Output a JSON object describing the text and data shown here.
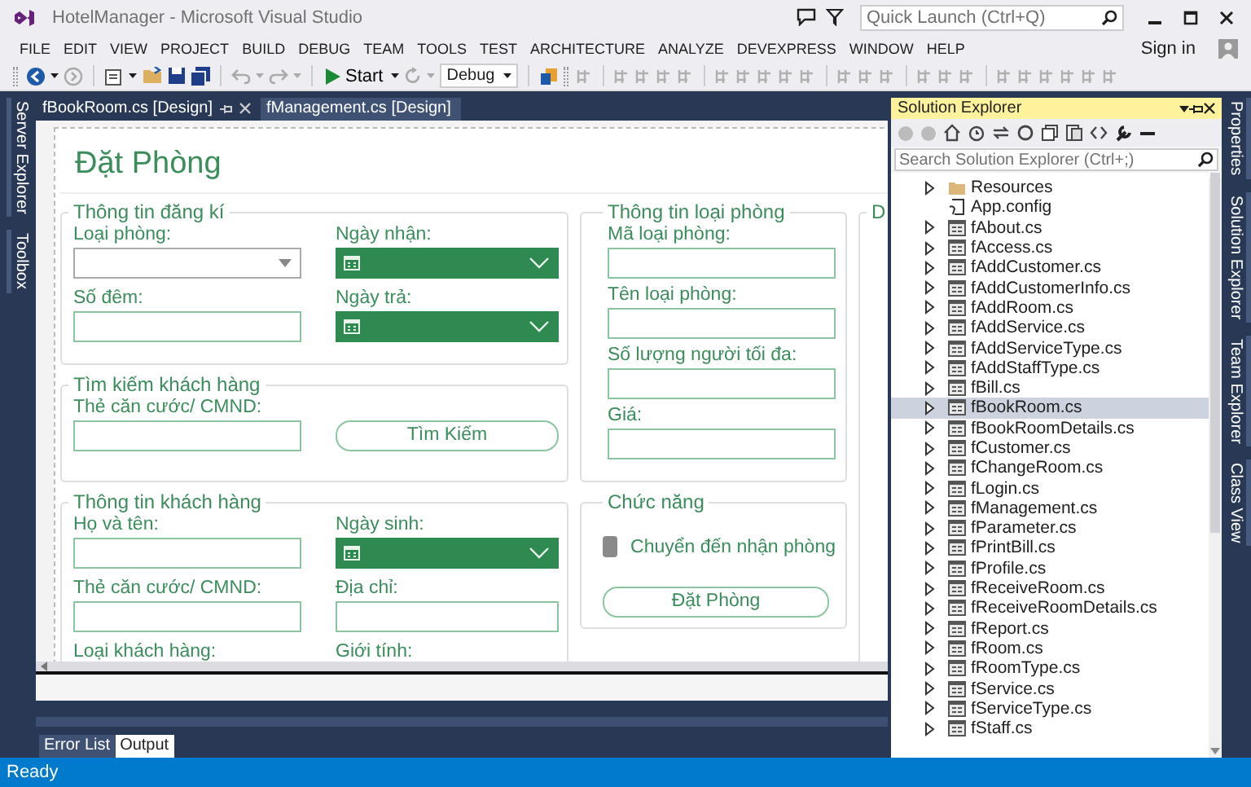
{
  "window": {
    "title": "HotelManager - Microsoft Visual Studio"
  },
  "quick_launch": {
    "placeholder": "Quick Launch (Ctrl+Q)"
  },
  "menu": [
    "FILE",
    "EDIT",
    "VIEW",
    "PROJECT",
    "BUILD",
    "DEBUG",
    "TEAM",
    "TOOLS",
    "TEST",
    "ARCHITECTURE",
    "ANALYZE",
    "DEVEXPRESS",
    "WINDOW",
    "HELP"
  ],
  "account": {
    "label": "Sign in"
  },
  "toolbar": {
    "start": "Start",
    "configuration": "Debug"
  },
  "left_side_tabs": [
    "Server Explorer",
    "Toolbox"
  ],
  "document_tabs": [
    {
      "label": "fBookRoom.cs [Design]",
      "selected": true
    },
    {
      "label": "fManagement.cs [Design]",
      "selected": false
    }
  ],
  "form": {
    "title": "Đặt Phòng",
    "columns": [
      [
        {
          "title": "Thông tin đăng kí",
          "fields": [
            {
              "label": "Loại phòng:",
              "kind": "combo"
            },
            {
              "label": "Ngày nhận:",
              "kind": "date"
            },
            {
              "label": "Số đêm:",
              "kind": "text"
            },
            {
              "label": "Ngày trả:",
              "kind": "date"
            }
          ]
        },
        {
          "title": "Tìm kiếm khách hàng",
          "fields": [
            {
              "label": "Thẻ căn cước/ CMND:",
              "kind": "text"
            },
            {
              "label": "Tìm Kiếm",
              "kind": "button"
            }
          ]
        },
        {
          "title": "Thông tin khách hàng",
          "fields": [
            {
              "label": "Họ và tên:",
              "kind": "text"
            },
            {
              "label": "Ngày sinh:",
              "kind": "date"
            },
            {
              "label": "Thẻ căn cước/ CMND:",
              "kind": "text"
            },
            {
              "label": "Địa chỉ:",
              "kind": "text"
            },
            {
              "label": "Loại khách hàng:",
              "kind": "label"
            },
            {
              "label": "Giới tính:",
              "kind": "label"
            }
          ]
        }
      ],
      [
        {
          "title": "Thông tin loại phòng",
          "fields": [
            {
              "label": "Mã loại phòng:",
              "kind": "text"
            },
            {
              "label": "Tên loại phòng:",
              "kind": "text"
            },
            {
              "label": "Số lượng người tối đa:",
              "kind": "text"
            },
            {
              "label": "Giá:",
              "kind": "text"
            }
          ]
        },
        {
          "title": "Chức năng",
          "fields": [
            {
              "label": "Chuyển đến nhận phòng",
              "kind": "checkbox",
              "checked": false
            },
            {
              "label": "Đặt Phòng",
              "kind": "button"
            }
          ]
        }
      ],
      [
        {
          "title": "D"
        }
      ]
    ]
  },
  "bottom_tabs": [
    {
      "label": "Error List",
      "selected": false
    },
    {
      "label": "Output",
      "selected": true
    }
  ],
  "solution_explorer": {
    "title": "Solution Explorer",
    "search": {
      "placeholder": "Search Solution Explorer (Ctrl+;)"
    },
    "items": [
      {
        "label": "Resources",
        "kind": "folder",
        "selected": false
      },
      {
        "label": "App.config",
        "kind": "config",
        "selected": false
      },
      {
        "label": "fAbout.cs",
        "kind": "form",
        "selected": false
      },
      {
        "label": "fAccess.cs",
        "kind": "form",
        "selected": false
      },
      {
        "label": "fAddCustomer.cs",
        "kind": "form",
        "selected": false
      },
      {
        "label": "fAddCustomerInfo.cs",
        "kind": "form",
        "selected": false
      },
      {
        "label": "fAddRoom.cs",
        "kind": "form",
        "selected": false
      },
      {
        "label": "fAddService.cs",
        "kind": "form",
        "selected": false
      },
      {
        "label": "fAddServiceType.cs",
        "kind": "form",
        "selected": false
      },
      {
        "label": "fAddStaffType.cs",
        "kind": "form",
        "selected": false
      },
      {
        "label": "fBill.cs",
        "kind": "form",
        "selected": false
      },
      {
        "label": "fBookRoom.cs",
        "kind": "form",
        "selected": true
      },
      {
        "label": "fBookRoomDetails.cs",
        "kind": "form",
        "selected": false
      },
      {
        "label": "fCustomer.cs",
        "kind": "form",
        "selected": false
      },
      {
        "label": "fChangeRoom.cs",
        "kind": "form",
        "selected": false
      },
      {
        "label": "fLogin.cs",
        "kind": "form",
        "selected": false
      },
      {
        "label": "fManagement.cs",
        "kind": "form",
        "selected": false
      },
      {
        "label": "fParameter.cs",
        "kind": "form",
        "selected": false
      },
      {
        "label": "fPrintBill.cs",
        "kind": "form",
        "selected": false
      },
      {
        "label": "fProfile.cs",
        "kind": "form",
        "selected": false
      },
      {
        "label": "fReceiveRoom.cs",
        "kind": "form",
        "selected": false
      },
      {
        "label": "fReceiveRoomDetails.cs",
        "kind": "form",
        "selected": false
      },
      {
        "label": "fReport.cs",
        "kind": "form",
        "selected": false
      },
      {
        "label": "fRoom.cs",
        "kind": "form",
        "selected": false
      },
      {
        "label": "fRoomType.cs",
        "kind": "form",
        "selected": false
      },
      {
        "label": "fService.cs",
        "kind": "form",
        "selected": false
      },
      {
        "label": "fServiceType.cs",
        "kind": "form",
        "selected": false
      },
      {
        "label": "fStaff.cs",
        "kind": "form",
        "selected": false
      }
    ]
  },
  "right_side_tabs": [
    "Properties",
    "Solution Explorer",
    "Team Explorer",
    "Class View"
  ],
  "status_bar": {
    "text": "Ready"
  }
}
